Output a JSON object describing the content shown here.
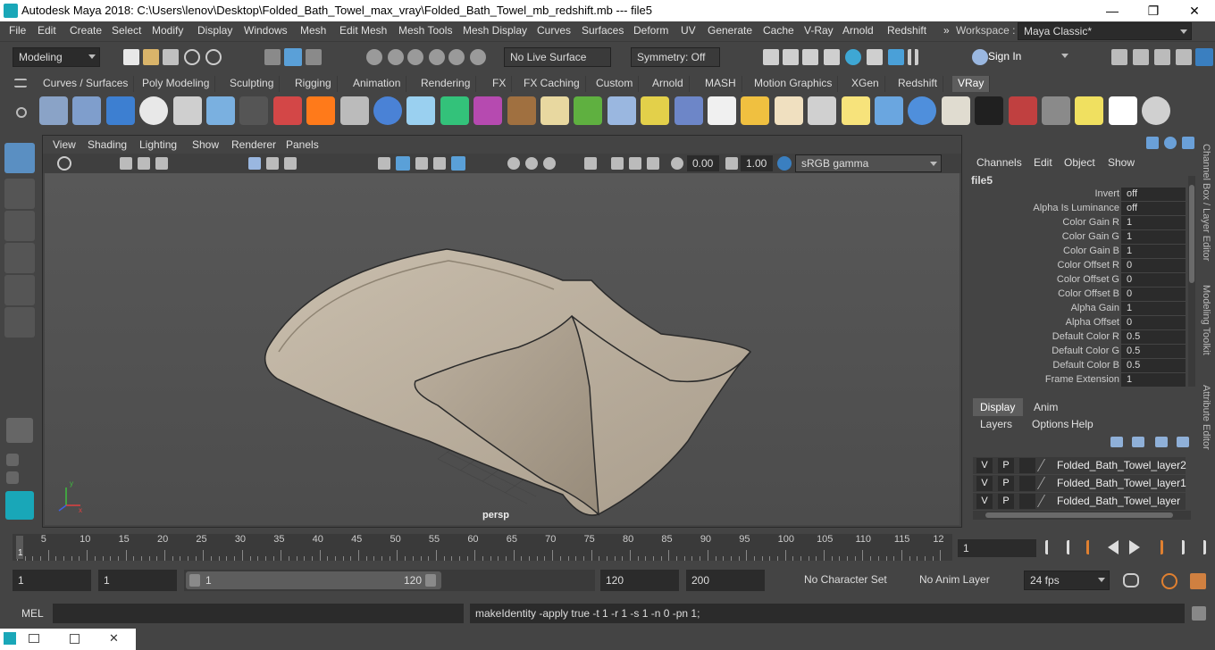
{
  "window": {
    "title": "Autodesk Maya 2018: C:\\Users\\lenov\\Desktop\\Folded_Bath_Towel_max_vray\\Folded_Bath_Towel_mb_redshift.mb   ---   file5",
    "minimize": "—",
    "maximize": "❐",
    "close": "✕"
  },
  "menubar": {
    "items": [
      "File",
      "Edit",
      "Create",
      "Select",
      "Modify",
      "Display",
      "Windows",
      "Mesh",
      "Edit Mesh",
      "Mesh Tools",
      "Mesh Display",
      "Curves",
      "Surfaces",
      "Deform",
      "UV",
      "Generate",
      "Cache",
      "V-Ray",
      "Arnold",
      "Redshift"
    ],
    "overflow": "»",
    "workspace_label": "Workspace :",
    "workspace_value": "Maya Classic*"
  },
  "statusline": {
    "menuset": "Modeling",
    "live_surface": "No Live Surface",
    "symmetry": "Symmetry: Off",
    "sign_in": "Sign In"
  },
  "shelf": {
    "tabs": [
      "Curves / Surfaces",
      "Poly Modeling",
      "Sculpting",
      "Rigging",
      "Animation",
      "Rendering",
      "FX",
      "FX Caching",
      "Custom",
      "Arnold",
      "MASH",
      "Motion Graphics",
      "XGen",
      "Redshift",
      "VRay"
    ],
    "active_tab": "VRay",
    "icon_colors": [
      "#8aa3c7",
      "#7f9ecc",
      "#3d7fd1",
      "#e8e8e8",
      "#cfcfcf",
      "#7ab0e0",
      "#555555",
      "#d34747",
      "#ff7a1a",
      "#bbbbbb",
      "#4a82d6",
      "#9ad0f0",
      "#33c27a",
      "#b64ab0",
      "#a07040",
      "#e8d8a0",
      "#5fb040",
      "#9ab7e0",
      "#e3d04a",
      "#6d86c8",
      "#f0f0f0",
      "#f0c040",
      "#f0e0c0",
      "#d0d0d0",
      "#f7e37b",
      "#6aa6e0",
      "#4f8fdc",
      "#e0dcd0",
      "#202020",
      "#c04040",
      "#8a8a8a",
      "#f0e060",
      "#ffffff",
      "#d0d0d0"
    ]
  },
  "viewport": {
    "menus": [
      "View",
      "Shading",
      "Lighting",
      "Show",
      "Renderer",
      "Panels"
    ],
    "exposure": "0.00",
    "gamma": "1.00",
    "color_space": "sRGB gamma",
    "camera_label": "persp",
    "towel_color": "#c8bcab"
  },
  "channelbox": {
    "menus": [
      "Channels",
      "Edit",
      "Object",
      "Show"
    ],
    "node_name": "file5",
    "attributes": [
      {
        "label": "Invert",
        "value": "off"
      },
      {
        "label": "Alpha Is Luminance",
        "value": "off"
      },
      {
        "label": "Color Gain R",
        "value": "1"
      },
      {
        "label": "Color Gain G",
        "value": "1"
      },
      {
        "label": "Color Gain B",
        "value": "1"
      },
      {
        "label": "Color Offset R",
        "value": "0"
      },
      {
        "label": "Color Offset G",
        "value": "0"
      },
      {
        "label": "Color Offset B",
        "value": "0"
      },
      {
        "label": "Alpha Gain",
        "value": "1"
      },
      {
        "label": "Alpha Offset",
        "value": "0"
      },
      {
        "label": "Default Color R",
        "value": "0.5"
      },
      {
        "label": "Default Color G",
        "value": "0.5"
      },
      {
        "label": "Default Color B",
        "value": "0.5"
      },
      {
        "label": "Frame Extension",
        "value": "1"
      }
    ]
  },
  "layers": {
    "tabs": [
      "Display",
      "Anim"
    ],
    "menus": [
      "Layers",
      "Options",
      "Help"
    ],
    "rows": [
      {
        "v": "V",
        "p": "P",
        "name": "Folded_Bath_Towel_layer2"
      },
      {
        "v": "V",
        "p": "P",
        "name": "Folded_Bath_Towel_layer1"
      },
      {
        "v": "V",
        "p": "P",
        "name": "Folded_Bath_Towel_layer"
      }
    ]
  },
  "sidetabs": [
    "Channel Box / Layer Editor",
    "Modeling Toolkit",
    "Attribute Editor"
  ],
  "timeslider": {
    "ticks": [
      "5",
      "10",
      "15",
      "20",
      "25",
      "30",
      "35",
      "40",
      "45",
      "50",
      "55",
      "60",
      "65",
      "70",
      "75",
      "80",
      "85",
      "90",
      "95",
      "100",
      "105",
      "110",
      "115",
      "12"
    ],
    "start_marker": "1",
    "current_frame": "1"
  },
  "range": {
    "start": "1",
    "playback_start": "1",
    "slider_start": "1",
    "slider_end": "120",
    "playback_end": "120",
    "end": "200",
    "character_set": "No Character Set",
    "anim_layer": "No Anim Layer",
    "fps": "24 fps"
  },
  "command": {
    "lang": "MEL",
    "output": "makeIdentity -apply true -t 1 -r 1 -s 1 -n 0 -pn 1;"
  }
}
